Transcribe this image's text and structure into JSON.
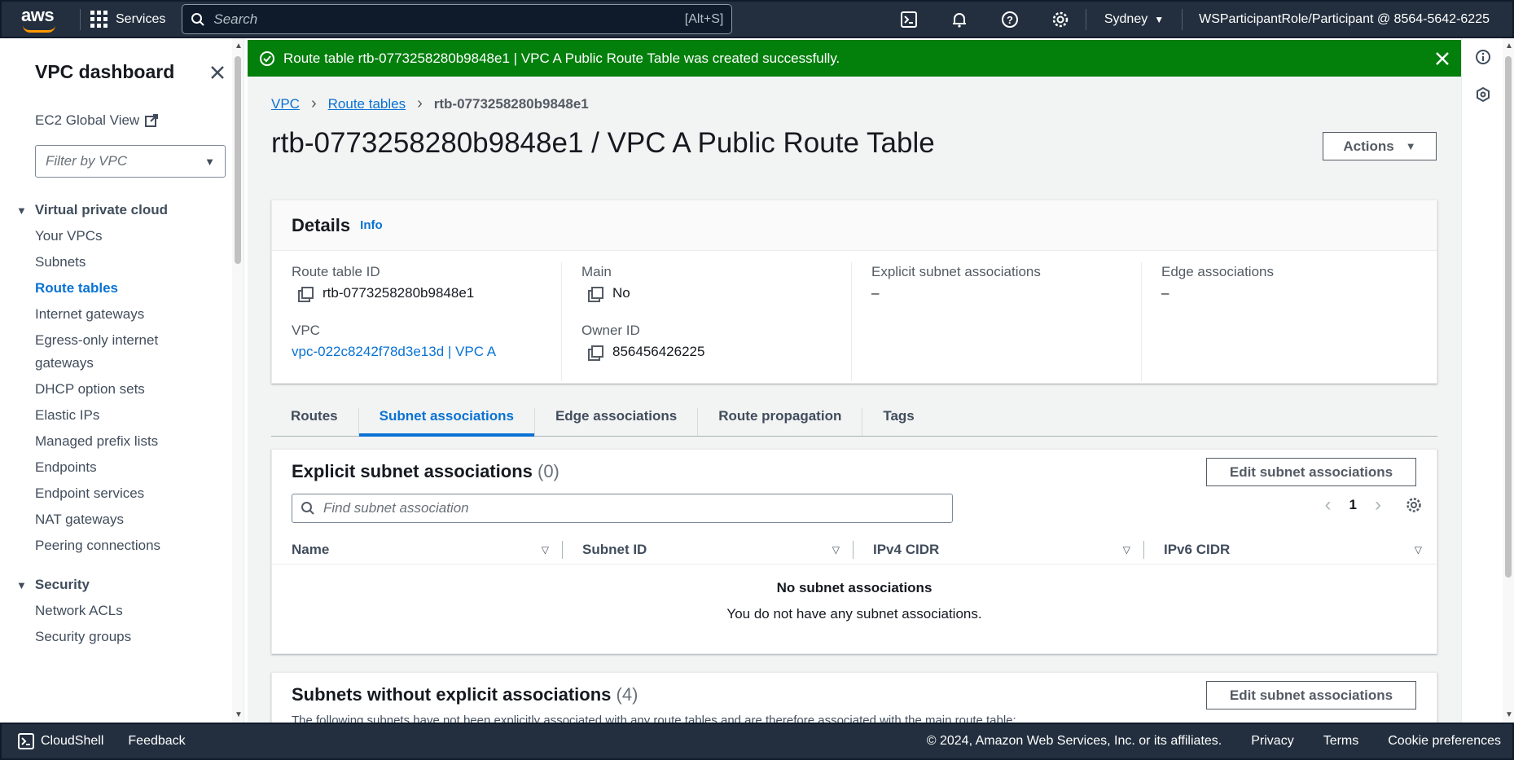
{
  "topnav": {
    "logo": "aws",
    "services": "Services",
    "search_placeholder": "Search",
    "search_hint": "[Alt+S]",
    "region": "Sydney",
    "user": "WSParticipantRole/Participant @ 8564-5642-6225"
  },
  "flash": {
    "message": "Route table rtb-0773258280b9848e1 | VPC A Public Route Table was created successfully."
  },
  "sidebar": {
    "title": "VPC dashboard",
    "global_view": "EC2 Global View",
    "filter_placeholder": "Filter by VPC",
    "section_vpc": "Virtual private cloud",
    "items": [
      "Your VPCs",
      "Subnets",
      "Route tables",
      "Internet gateways",
      "Egress-only internet gateways",
      "DHCP option sets",
      "Elastic IPs",
      "Managed prefix lists",
      "Endpoints",
      "Endpoint services",
      "NAT gateways",
      "Peering connections"
    ],
    "section_security": "Security",
    "security_items": [
      "Network ACLs",
      "Security groups"
    ]
  },
  "breadcrumb": {
    "vpc": "VPC",
    "route_tables": "Route tables",
    "current": "rtb-0773258280b9848e1"
  },
  "page": {
    "title": "rtb-0773258280b9848e1 / VPC A Public Route Table",
    "actions": "Actions"
  },
  "details": {
    "heading": "Details",
    "info": "Info",
    "route_table_id_label": "Route table ID",
    "route_table_id": "rtb-0773258280b9848e1",
    "vpc_label": "VPC",
    "vpc": "vpc-022c8242f78d3e13d | VPC A",
    "main_label": "Main",
    "main": "No",
    "owner_label": "Owner ID",
    "owner": "856456426225",
    "explicit_label": "Explicit subnet associations",
    "explicit": "–",
    "edge_label": "Edge associations",
    "edge": "–"
  },
  "tabs": [
    "Routes",
    "Subnet associations",
    "Edge associations",
    "Route propagation",
    "Tags"
  ],
  "explicit_assoc": {
    "title": "Explicit subnet associations",
    "count": "(0)",
    "edit": "Edit subnet associations",
    "find_placeholder": "Find subnet association",
    "page": "1",
    "columns": [
      "Name",
      "Subnet ID",
      "IPv4 CIDR",
      "IPv6 CIDR"
    ],
    "empty_title": "No subnet associations",
    "empty_text": "You do not have any subnet associations."
  },
  "without_assoc": {
    "title": "Subnets without explicit associations",
    "count": "(4)",
    "edit": "Edit subnet associations",
    "desc": "The following subnets have not been explicitly associated with any route tables and are therefore associated with the main route table:"
  },
  "footer": {
    "cloudshell": "CloudShell",
    "feedback": "Feedback",
    "copyright": "© 2024, Amazon Web Services, Inc. or its affiliates.",
    "privacy": "Privacy",
    "terms": "Terms",
    "cookies": "Cookie preferences"
  },
  "colors": {
    "nav_bg": "#232f3e",
    "success_green": "#037f0c",
    "link_blue": "#0972d3",
    "aws_orange": "#ff9900"
  }
}
